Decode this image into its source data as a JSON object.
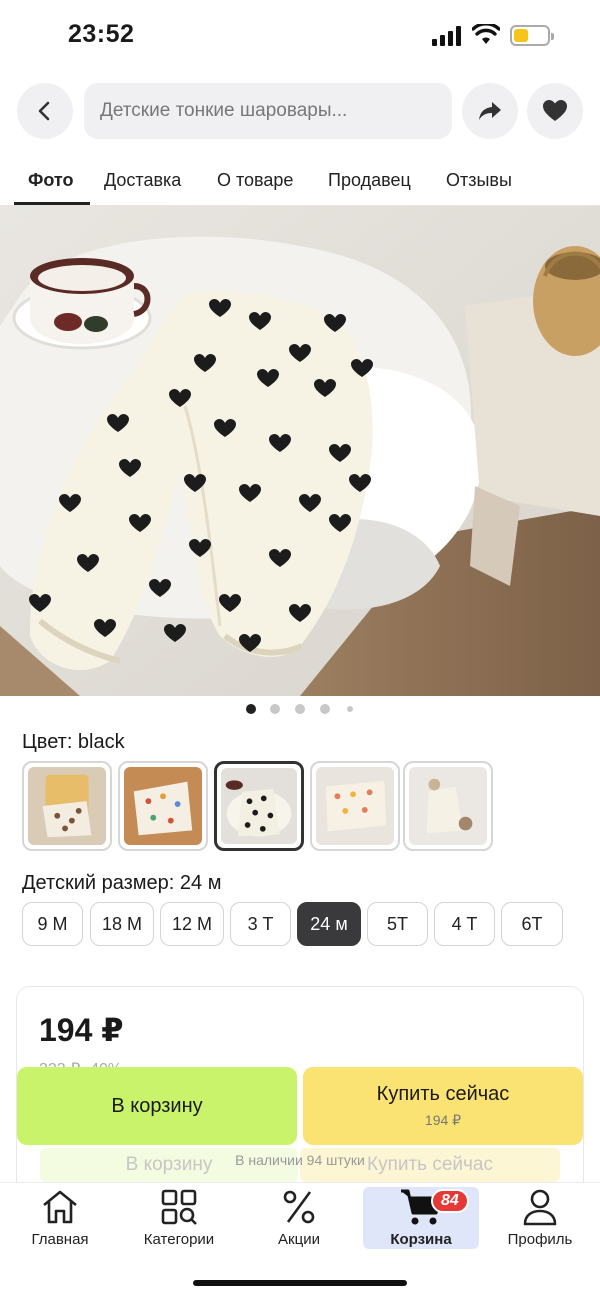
{
  "status_bar": {
    "time": "23:52"
  },
  "search": {
    "value": "Детские тонкие шаровары..."
  },
  "tabs": [
    {
      "label": "Фото",
      "active": true
    },
    {
      "label": "Доставка"
    },
    {
      "label": "О товаре"
    },
    {
      "label": "Продавец"
    },
    {
      "label": "Отзывы"
    }
  ],
  "gallery": {
    "image_count": 5,
    "current_index": 1
  },
  "color": {
    "label": "Цвет: black",
    "thumbnails": [
      "ginger bear",
      "multicolor print",
      "black hearts",
      "flowers",
      "cream"
    ],
    "selected_index": 2
  },
  "size": {
    "label": "Детский размер: 24 м",
    "options": [
      "9 M",
      "18 M",
      "12 M",
      "3 T",
      "24 м",
      "5T",
      "4 T",
      "6T"
    ],
    "selected_index": 4
  },
  "price": {
    "current": "194 ₽",
    "old": "323 ₽  -40%"
  },
  "actions": {
    "cart_label": "В корзину",
    "buy_label": "Купить сейчас",
    "buy_price": "194 ₽",
    "ghost_cart": "В корзину",
    "ghost_buy": "Купить сейчас",
    "stock": "В наличии 94 штуки"
  },
  "nav": {
    "items": [
      {
        "label": "Главная",
        "icon": "home-icon"
      },
      {
        "label": "Категории",
        "icon": "categories-icon"
      },
      {
        "label": "Акции",
        "icon": "percent-icon"
      },
      {
        "label": "Корзина",
        "icon": "cart-icon",
        "active": true,
        "badge": "84"
      },
      {
        "label": "Профиль",
        "icon": "profile-icon"
      }
    ]
  },
  "colors": {
    "cart_button": "#c9f36b",
    "buy_button": "#fbe373",
    "badge": "#e53935",
    "active_nav": "#dfe6f9"
  }
}
